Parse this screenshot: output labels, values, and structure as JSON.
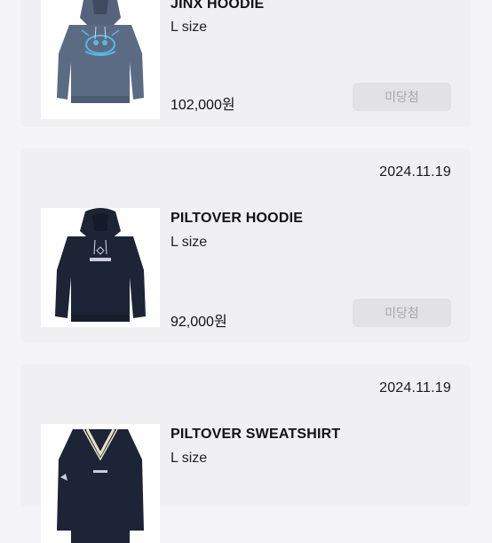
{
  "orders": [
    {
      "date": "",
      "product_name": "JINX HOODIE",
      "option": "L size",
      "price": "102,000원",
      "status": "미당첨",
      "image_icon": "jinx-hoodie-image"
    },
    {
      "date": "2024.11.19",
      "product_name": "PILTOVER HOODIE",
      "option": "L size",
      "price": "92,000원",
      "status": "미당첨",
      "image_icon": "piltover-hoodie-image"
    },
    {
      "date": "2024.11.19",
      "product_name": "PILTOVER SWEATSHIRT",
      "option": "L size",
      "price": "",
      "status": "",
      "image_icon": "piltover-sweatshirt-image"
    }
  ],
  "colors": {
    "card_bg": "#f0f0f3",
    "page_bg": "#f4f4f6",
    "button_bg": "#e2e2e6",
    "button_text": "#a6a6ab",
    "jinx_hoodie": "#5b6b83",
    "jinx_print": "#58b8e6",
    "navy": "#1d2436"
  }
}
